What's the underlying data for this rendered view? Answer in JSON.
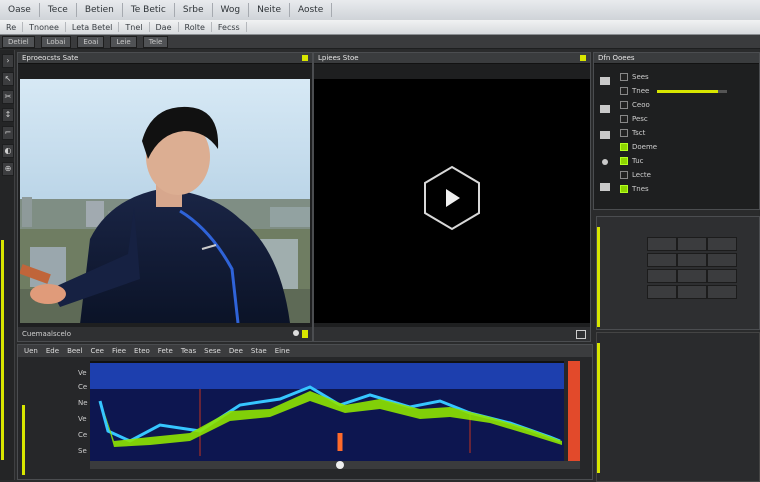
{
  "menubar": {
    "items": [
      "Oase",
      "Tece",
      "Betien",
      "Te Betic",
      "Srbe",
      "Wog",
      "Neite",
      "Aoste"
    ]
  },
  "toolbar": {
    "items": [
      "Re",
      "Tnonee",
      "Leta Betel",
      "Tnel",
      "Dae",
      "Rolte",
      "Fecss"
    ]
  },
  "secondbar": {
    "items": [
      "Detiel",
      "Lobai",
      "Eoai",
      "Leie",
      "Tele"
    ]
  },
  "left_tools": [
    "›",
    "↖",
    "✂",
    "↕",
    "⌐",
    "◐",
    "⊕"
  ],
  "source_monitor": {
    "title": "Eproeocsts Sate",
    "footer_label": "Cuemaalscelo"
  },
  "program_monitor": {
    "title": "Lpiees Stoe"
  },
  "right_panel": {
    "title": "Dfn Ooees",
    "rows": [
      {
        "label": "Sees",
        "checked": false
      },
      {
        "label": "Tnee",
        "checked": false
      },
      {
        "label": "Ceoo",
        "checked": false
      },
      {
        "label": "Pesc",
        "checked": false
      },
      {
        "label": "Tsct",
        "checked": false
      },
      {
        "label": "Doeme",
        "checked": true
      },
      {
        "label": "Tuc",
        "checked": true
      },
      {
        "label": "Lecte",
        "checked": false
      },
      {
        "label": "Tnes",
        "checked": true
      }
    ],
    "slider_value": 0.86
  },
  "timeline": {
    "header_items": [
      "Uen",
      "Ede",
      "Beel",
      "Cee",
      "Fiee",
      "Eteo",
      "Fete",
      "Teas",
      "Sese",
      "Dee",
      "Stae",
      "Eine"
    ],
    "track_labels": [
      "Ve",
      "Ce",
      "Ne",
      "Ve",
      "Ce",
      "Se"
    ],
    "accent": "#8ee400",
    "wave_color": "#36c6ff",
    "graph_bg": "#1d3fae"
  },
  "colors": {
    "accent": "#d8e600",
    "panel_border": "#4b4d50"
  }
}
